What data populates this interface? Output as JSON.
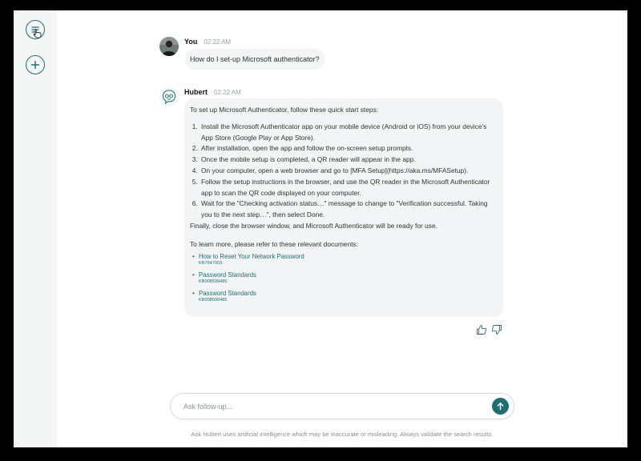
{
  "sidebar": {
    "icons": {
      "history": "history-menu-icon",
      "new_chat": "plus-icon"
    }
  },
  "conversation": {
    "user_message": {
      "author": "You",
      "time": "02:22 AM",
      "text": "How do I set-up Microsoft authenticator?"
    },
    "bot_message": {
      "author": "Hubert",
      "time": "02:22 AM",
      "intro": "To set up Microsoft Authenticator, follow these quick start steps:",
      "steps": [
        "Install the Microsoft Authenticator app on your mobile device (Android or iOS) from your device's App Store (Google Play or App Store).",
        "After installation, open the app and follow the on-screen setup prompts.",
        "Once the mobile setup is completed, a QR reader will appear in the app.",
        "On your computer, open a web browser and go to [MFA Setup](https://aka.ms/MFASetup).",
        "Follow the setup instructions in the browser, and use the QR reader in the Microsoft Authenticator app to scan the QR code displayed on your computer.",
        "Wait for the \"Checking activation status…\" message to change to \"Verification successful. Taking you to the next step…\", then select Done."
      ],
      "closing": "Finally, close the browser window, and Microsoft Authenticator will be ready for use.",
      "docs_intro": "To learn more, please refer to these relevant documents:",
      "docs": [
        {
          "title": "How to Reset Your Network Password",
          "id": "KB7647003"
        },
        {
          "title": "Password Standards",
          "id": "KB008599485"
        },
        {
          "title": "Password Standards",
          "id": "KB008599485"
        }
      ]
    },
    "feedback": {
      "like_icon": "thumbs-up-icon",
      "dislike_icon": "thumbs-down-icon"
    }
  },
  "composer": {
    "placeholder": "Ask follow-up...",
    "value": "",
    "send_icon": "arrow-up-icon"
  },
  "disclaimer": "Ask Hubert uses artificial intelligence which may be inaccurate or misleading. Always validate the search results.",
  "colors": {
    "accent": "#1e6f74",
    "bubble": "#f3f4f5",
    "rail": "#f4f5f5"
  }
}
